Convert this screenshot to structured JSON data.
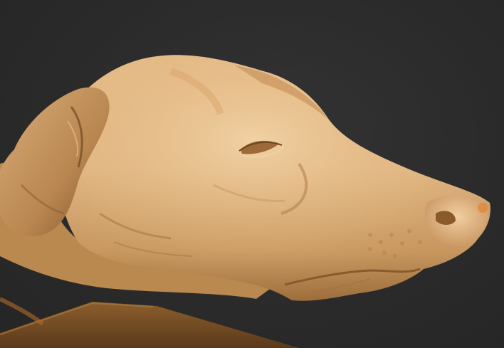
{
  "scene": {
    "subject": "dog-head-volume-render",
    "colors": {
      "background": "#2a2a2a",
      "skin_light": "#e9c596",
      "skin_mid": "#d2a56d",
      "skin_dark": "#8a5f33",
      "shadow": "#4a3018",
      "highlight": "#f7dcb2",
      "table": "#7a5226",
      "accent_orange": "#e08a3a"
    }
  }
}
